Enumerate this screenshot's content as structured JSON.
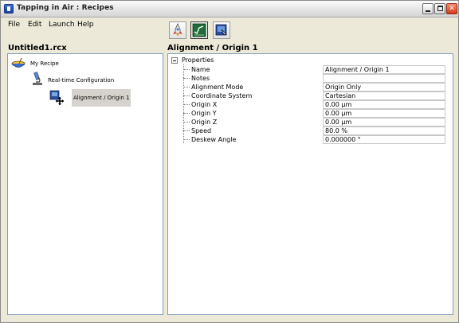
{
  "window": {
    "title": "Tapping in Air : Recipes",
    "buttons": {
      "minimize": "",
      "maximize": "",
      "close": "✕"
    }
  },
  "menu": {
    "items": [
      "File",
      "Edit",
      "Launch",
      "Help"
    ]
  },
  "toolbar": {
    "buttons": [
      {
        "icon": "rocket-icon"
      },
      {
        "icon": "chart-icon",
        "active": true
      },
      {
        "icon": "recipe-step-icon"
      }
    ]
  },
  "left_panel": {
    "title": "Untitled1.rcx",
    "tree": [
      {
        "label": "My Recipe",
        "icon": "bowl-icon"
      },
      {
        "label": "Real-time Configuration",
        "icon": "microscope-icon"
      },
      {
        "label": "Alignment / Origin 1",
        "icon": "alignment-icon",
        "selected": true
      }
    ]
  },
  "right_panel": {
    "title": "Alignment / Origin 1",
    "root_label": "Properties",
    "properties": [
      {
        "name": "Name",
        "value": "Alignment / Origin 1"
      },
      {
        "name": "Notes",
        "value": ""
      },
      {
        "name": "Alignment Mode",
        "value": "Origin Only"
      },
      {
        "name": "Coordinate System",
        "value": "Cartesian"
      },
      {
        "name": "Origin X",
        "value": "0.00 µm"
      },
      {
        "name": "Origin Y",
        "value": "0.00 µm"
      },
      {
        "name": "Origin Z",
        "value": "0.00 µm"
      },
      {
        "name": "Speed",
        "value": "80.0 %"
      },
      {
        "name": "Deskew Angle",
        "value": "0.000000 °"
      }
    ]
  }
}
